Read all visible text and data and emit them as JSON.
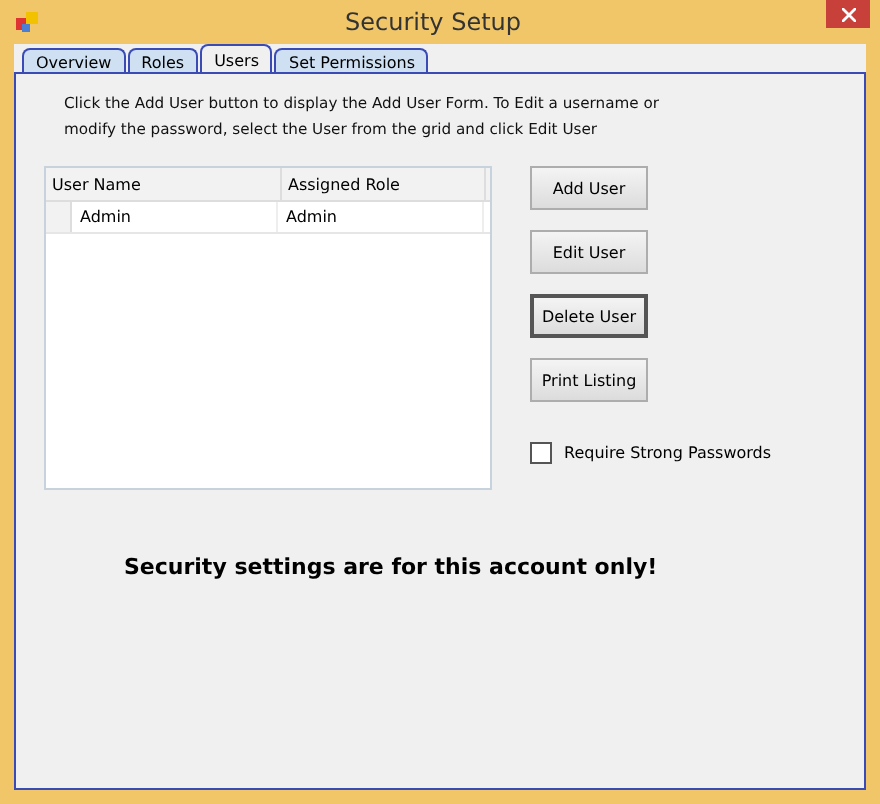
{
  "window": {
    "title": "Security Setup"
  },
  "tabs": [
    {
      "label": "Overview",
      "selected": false
    },
    {
      "label": "Roles",
      "selected": false
    },
    {
      "label": "Users",
      "selected": true
    },
    {
      "label": "Set Permissions",
      "selected": false
    }
  ],
  "instructions": "Click the Add User button to display the Add User Form.  To Edit a username or modify the password, select the User from the grid and click Edit User",
  "grid": {
    "columns": [
      "User Name",
      "Assigned Role"
    ],
    "rows": [
      [
        "Admin",
        "Admin"
      ]
    ]
  },
  "buttons": [
    {
      "label": "Add User",
      "focused": false
    },
    {
      "label": "Edit User",
      "focused": false
    },
    {
      "label": "Delete User",
      "focused": true
    },
    {
      "label": "Print Listing",
      "focused": false
    }
  ],
  "require_strong_passwords": {
    "label": "Require Strong Passwords",
    "checked": false
  },
  "notice": "Security settings are for this account only!"
}
